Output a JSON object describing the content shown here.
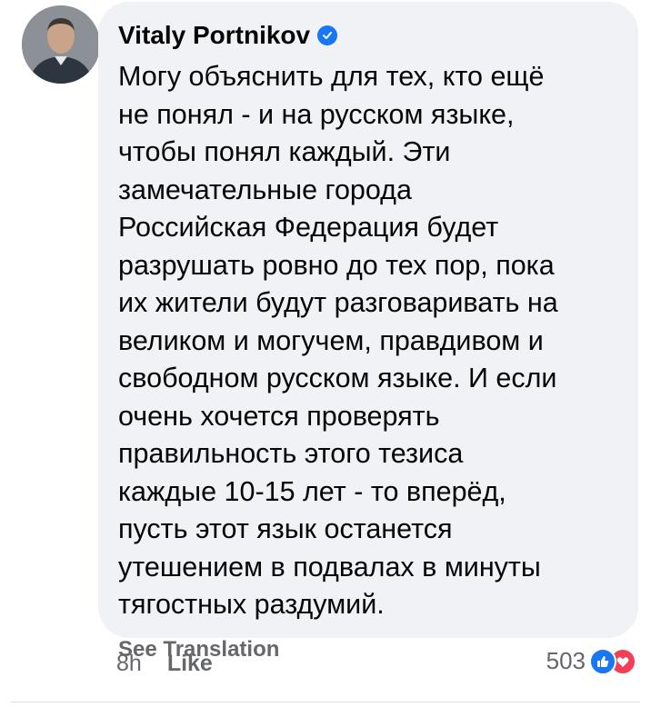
{
  "comment": {
    "author": "Vitaly Portnikov",
    "verified_icon": "verified-badge-icon",
    "text": "Могу объяснить для тех, кто ещё\nне понял - и на русском языке,\nчтобы понял каждый. Эти\nзамечательные города\nРоссийская Федерация будет\nразрушать ровно до тех пор, пока\nих жители будут разговаривать на\nвеликом и могучем, правдивом и\nсвободном русском языке. И если\nочень хочется проверять\nправильность этого тезиса\nкаждые 10-15 лет - то вперёд,\nпусть этот язык останется\nутешением в подвалах в минуты\nтягостных раздумий.",
    "see_translation": "See Translation",
    "time": "8h",
    "like_label": "Like",
    "reaction_count": "503",
    "reaction_icons": [
      "like-icon",
      "love-icon"
    ]
  },
  "colors": {
    "bubble_bg": "#f0f2f5",
    "text": "#050505",
    "secondary": "#65676b",
    "verified": "#1877f2",
    "like": "#1877f2",
    "love": "#f33e58"
  }
}
